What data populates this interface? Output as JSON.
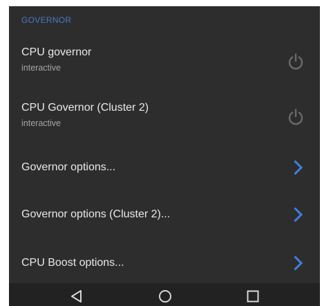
{
  "section": {
    "header": "GOVERNOR"
  },
  "rows": [
    {
      "title": "CPU governor",
      "summary": "interactive",
      "control": "power-icon"
    },
    {
      "title": "CPU Governor (Cluster 2)",
      "summary": "interactive",
      "control": "power-icon"
    },
    {
      "title": "Governor options...",
      "control": "chevron-right-icon"
    },
    {
      "title": "Governor options (Cluster 2)...",
      "control": "chevron-right-icon"
    },
    {
      "title": "CPU Boost options...",
      "control": "chevron-right-icon"
    }
  ],
  "navbar": {
    "buttons": [
      "back-icon",
      "home-icon",
      "recents-icon"
    ]
  },
  "colors": {
    "background": "#2d2d2d",
    "accent": "#4a79c9",
    "chevron": "#3f7fe0",
    "icon_muted": "#6a6a6a",
    "title_text": "#e9e9e9",
    "summary_text": "#a6a6a6",
    "navbar_bg": "#222222"
  }
}
